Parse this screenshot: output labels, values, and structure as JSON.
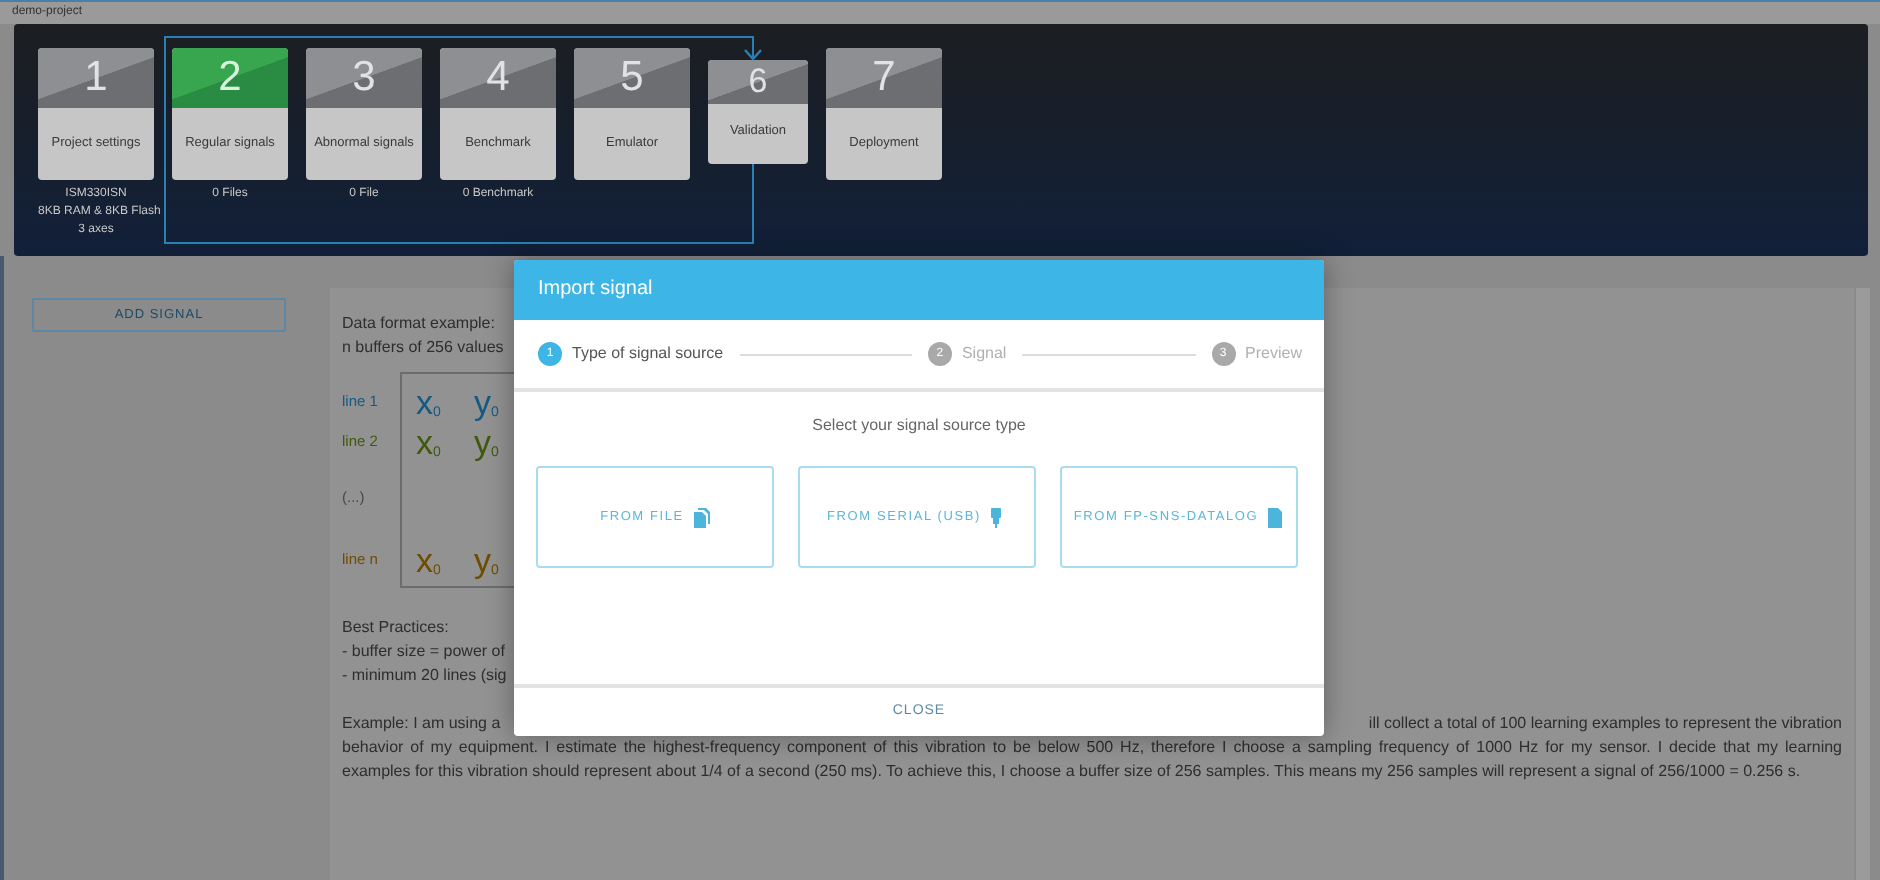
{
  "window": {
    "title": "demo-project"
  },
  "steps": [
    {
      "number": "1",
      "label": "Project settings",
      "kind": "step",
      "selected": false,
      "details": [
        "ISM330ISN",
        "8KB RAM & 8KB Flash",
        "3 axes"
      ]
    },
    {
      "number": "2",
      "label": "Regular signals",
      "kind": "step",
      "selected": true,
      "details": [
        "0 Files"
      ]
    },
    {
      "number": "3",
      "label": "Abnormal signals",
      "kind": "step",
      "selected": false,
      "details": [
        "0 File"
      ]
    },
    {
      "number": "4",
      "label": "Benchmark",
      "kind": "step",
      "selected": false,
      "details": [
        "0 Benchmark"
      ]
    },
    {
      "number": "5",
      "label": "Emulator",
      "kind": "step",
      "selected": false
    },
    {
      "number": "6",
      "label": "Validation",
      "kind": "loop",
      "selected": false
    },
    {
      "number": "7",
      "label": "Deployment",
      "kind": "step",
      "selected": false
    }
  ],
  "sidebar": {
    "add_button": "ADD SIGNAL"
  },
  "content": {
    "format_title": "Data format example:",
    "format_subtitle": "n buffers of 256 values",
    "format_rows": [
      {
        "label": "line 1",
        "color": "#145a82",
        "cells": [
          "x$_{0}$",
          "y$_{0}$"
        ]
      },
      {
        "label": "line 2",
        "color": "#3f5a0c",
        "cells": [
          "x$_{0}$",
          "y$_{0}$"
        ]
      },
      {
        "label": "(...)",
        "color": "#4a4a4a",
        "cells": []
      },
      {
        "label": "line n",
        "color": "#6e4c00",
        "cells": [
          "x$_{0}$",
          "y$_{0}$"
        ]
      }
    ],
    "best_practices_title": "Best Practices:",
    "best_practices": [
      "- buffer size = power of",
      "- minimum 20 lines (sig"
    ],
    "example_lines": [
      [
        "Example: I am using a",
        "ill collect a total of 100 learning examples to represent the vibration"
      ],
      [
        "behavior of my equipment. I estimate the highest-frequency component of this vibration to be below 500 Hz, therefore I choose a sampling frequency of 1000 Hz for my sensor. I decide that my learning"
      ],
      [
        "examples for this vibration should represent about 1/4 of a second (250 ms). To achieve this, I choose a buffer size of 256 samples. This means my 256 samples will represent a signal of 256/1000 = 0.256 s."
      ]
    ]
  },
  "modal": {
    "title": "Import signal",
    "steps": [
      {
        "number": "1",
        "label": "Type of signal source",
        "selected": true
      },
      {
        "number": "2",
        "label": "Signal",
        "selected": false
      },
      {
        "number": "3",
        "label": "Preview",
        "selected": false
      }
    ],
    "prompt": "Select your signal source type",
    "options": [
      {
        "label": "FROM FILE",
        "kind": "file"
      },
      {
        "label": "FROM SERIAL (USB)",
        "kind": "usb"
      },
      {
        "label": "FROM FP-SNS-DATALOG",
        "kind": "sdcard"
      }
    ],
    "close": "CLOSE"
  }
}
